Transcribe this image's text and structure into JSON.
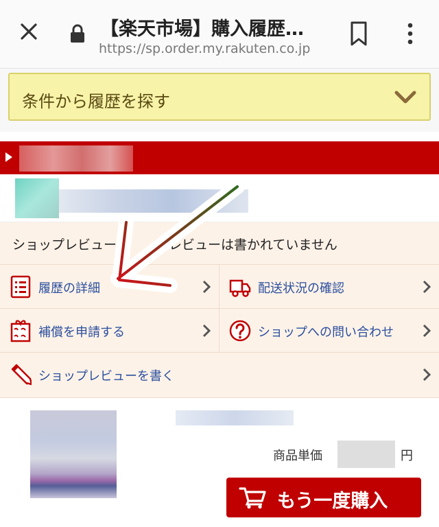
{
  "browser": {
    "title": "【楽天市場】購入履歴…",
    "url": "https://sp.order.my.rakuten.co.jp"
  },
  "search": {
    "label": "条件から履歴を探す"
  },
  "review_status": {
    "text": "ショップレビュー　　　　レビューは書かれていません"
  },
  "actions": [
    {
      "label": "履歴の詳細",
      "icon": "list-document-icon"
    },
    {
      "label": "配送状況の確認",
      "icon": "truck-icon"
    },
    {
      "label": "補償を申請する",
      "icon": "anshin-gift-icon"
    },
    {
      "label": "ショップへの問い合わせ",
      "icon": "question-circle-icon"
    },
    {
      "label": "ショップレビューを書く",
      "icon": "pencil-icon"
    }
  ],
  "product": {
    "unit_price_label": "商品単価",
    "currency": "円",
    "buy_again_label": "もう一度購入"
  },
  "colors": {
    "brand_red": "#c00000",
    "link_blue": "#2b4f9e",
    "panel_bg": "#fdf2e8",
    "search_bg": "#f7f3a9"
  }
}
